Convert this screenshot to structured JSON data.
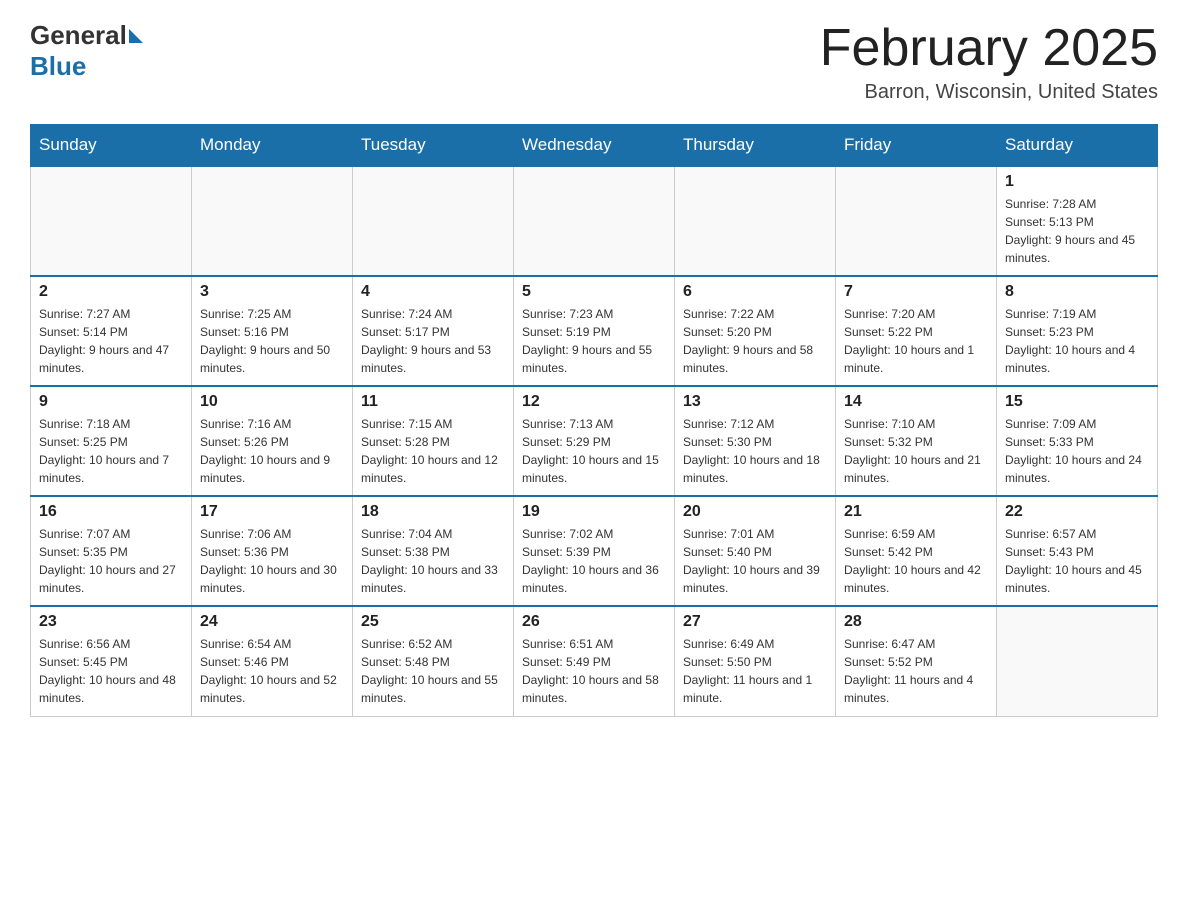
{
  "header": {
    "logo_general": "General",
    "logo_blue": "Blue",
    "month_title": "February 2025",
    "location": "Barron, Wisconsin, United States"
  },
  "days_of_week": [
    "Sunday",
    "Monday",
    "Tuesday",
    "Wednesday",
    "Thursday",
    "Friday",
    "Saturday"
  ],
  "weeks": [
    [
      {
        "day": "",
        "sunrise": "",
        "sunset": "",
        "daylight": ""
      },
      {
        "day": "",
        "sunrise": "",
        "sunset": "",
        "daylight": ""
      },
      {
        "day": "",
        "sunrise": "",
        "sunset": "",
        "daylight": ""
      },
      {
        "day": "",
        "sunrise": "",
        "sunset": "",
        "daylight": ""
      },
      {
        "day": "",
        "sunrise": "",
        "sunset": "",
        "daylight": ""
      },
      {
        "day": "",
        "sunrise": "",
        "sunset": "",
        "daylight": ""
      },
      {
        "day": "1",
        "sunrise": "Sunrise: 7:28 AM",
        "sunset": "Sunset: 5:13 PM",
        "daylight": "Daylight: 9 hours and 45 minutes."
      }
    ],
    [
      {
        "day": "2",
        "sunrise": "Sunrise: 7:27 AM",
        "sunset": "Sunset: 5:14 PM",
        "daylight": "Daylight: 9 hours and 47 minutes."
      },
      {
        "day": "3",
        "sunrise": "Sunrise: 7:25 AM",
        "sunset": "Sunset: 5:16 PM",
        "daylight": "Daylight: 9 hours and 50 minutes."
      },
      {
        "day": "4",
        "sunrise": "Sunrise: 7:24 AM",
        "sunset": "Sunset: 5:17 PM",
        "daylight": "Daylight: 9 hours and 53 minutes."
      },
      {
        "day": "5",
        "sunrise": "Sunrise: 7:23 AM",
        "sunset": "Sunset: 5:19 PM",
        "daylight": "Daylight: 9 hours and 55 minutes."
      },
      {
        "day": "6",
        "sunrise": "Sunrise: 7:22 AM",
        "sunset": "Sunset: 5:20 PM",
        "daylight": "Daylight: 9 hours and 58 minutes."
      },
      {
        "day": "7",
        "sunrise": "Sunrise: 7:20 AM",
        "sunset": "Sunset: 5:22 PM",
        "daylight": "Daylight: 10 hours and 1 minute."
      },
      {
        "day": "8",
        "sunrise": "Sunrise: 7:19 AM",
        "sunset": "Sunset: 5:23 PM",
        "daylight": "Daylight: 10 hours and 4 minutes."
      }
    ],
    [
      {
        "day": "9",
        "sunrise": "Sunrise: 7:18 AM",
        "sunset": "Sunset: 5:25 PM",
        "daylight": "Daylight: 10 hours and 7 minutes."
      },
      {
        "day": "10",
        "sunrise": "Sunrise: 7:16 AM",
        "sunset": "Sunset: 5:26 PM",
        "daylight": "Daylight: 10 hours and 9 minutes."
      },
      {
        "day": "11",
        "sunrise": "Sunrise: 7:15 AM",
        "sunset": "Sunset: 5:28 PM",
        "daylight": "Daylight: 10 hours and 12 minutes."
      },
      {
        "day": "12",
        "sunrise": "Sunrise: 7:13 AM",
        "sunset": "Sunset: 5:29 PM",
        "daylight": "Daylight: 10 hours and 15 minutes."
      },
      {
        "day": "13",
        "sunrise": "Sunrise: 7:12 AM",
        "sunset": "Sunset: 5:30 PM",
        "daylight": "Daylight: 10 hours and 18 minutes."
      },
      {
        "day": "14",
        "sunrise": "Sunrise: 7:10 AM",
        "sunset": "Sunset: 5:32 PM",
        "daylight": "Daylight: 10 hours and 21 minutes."
      },
      {
        "day": "15",
        "sunrise": "Sunrise: 7:09 AM",
        "sunset": "Sunset: 5:33 PM",
        "daylight": "Daylight: 10 hours and 24 minutes."
      }
    ],
    [
      {
        "day": "16",
        "sunrise": "Sunrise: 7:07 AM",
        "sunset": "Sunset: 5:35 PM",
        "daylight": "Daylight: 10 hours and 27 minutes."
      },
      {
        "day": "17",
        "sunrise": "Sunrise: 7:06 AM",
        "sunset": "Sunset: 5:36 PM",
        "daylight": "Daylight: 10 hours and 30 minutes."
      },
      {
        "day": "18",
        "sunrise": "Sunrise: 7:04 AM",
        "sunset": "Sunset: 5:38 PM",
        "daylight": "Daylight: 10 hours and 33 minutes."
      },
      {
        "day": "19",
        "sunrise": "Sunrise: 7:02 AM",
        "sunset": "Sunset: 5:39 PM",
        "daylight": "Daylight: 10 hours and 36 minutes."
      },
      {
        "day": "20",
        "sunrise": "Sunrise: 7:01 AM",
        "sunset": "Sunset: 5:40 PM",
        "daylight": "Daylight: 10 hours and 39 minutes."
      },
      {
        "day": "21",
        "sunrise": "Sunrise: 6:59 AM",
        "sunset": "Sunset: 5:42 PM",
        "daylight": "Daylight: 10 hours and 42 minutes."
      },
      {
        "day": "22",
        "sunrise": "Sunrise: 6:57 AM",
        "sunset": "Sunset: 5:43 PM",
        "daylight": "Daylight: 10 hours and 45 minutes."
      }
    ],
    [
      {
        "day": "23",
        "sunrise": "Sunrise: 6:56 AM",
        "sunset": "Sunset: 5:45 PM",
        "daylight": "Daylight: 10 hours and 48 minutes."
      },
      {
        "day": "24",
        "sunrise": "Sunrise: 6:54 AM",
        "sunset": "Sunset: 5:46 PM",
        "daylight": "Daylight: 10 hours and 52 minutes."
      },
      {
        "day": "25",
        "sunrise": "Sunrise: 6:52 AM",
        "sunset": "Sunset: 5:48 PM",
        "daylight": "Daylight: 10 hours and 55 minutes."
      },
      {
        "day": "26",
        "sunrise": "Sunrise: 6:51 AM",
        "sunset": "Sunset: 5:49 PM",
        "daylight": "Daylight: 10 hours and 58 minutes."
      },
      {
        "day": "27",
        "sunrise": "Sunrise: 6:49 AM",
        "sunset": "Sunset: 5:50 PM",
        "daylight": "Daylight: 11 hours and 1 minute."
      },
      {
        "day": "28",
        "sunrise": "Sunrise: 6:47 AM",
        "sunset": "Sunset: 5:52 PM",
        "daylight": "Daylight: 11 hours and 4 minutes."
      },
      {
        "day": "",
        "sunrise": "",
        "sunset": "",
        "daylight": ""
      }
    ]
  ]
}
